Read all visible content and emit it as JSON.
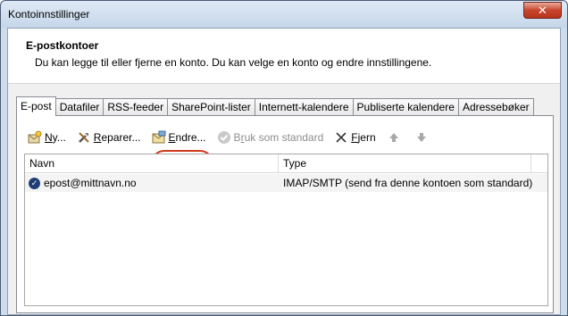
{
  "window": {
    "title": "Kontoinnstillinger",
    "close_glyph": "✕"
  },
  "header": {
    "title": "E-postkontoer",
    "subtitle": "Du kan legge til eller fjerne en konto. Du kan velge en konto og endre innstillingene."
  },
  "tabs": [
    {
      "label": "E-post",
      "active": true
    },
    {
      "label": "Datafiler"
    },
    {
      "label": "RSS-feeder"
    },
    {
      "label": "SharePoint-lister"
    },
    {
      "label": "Internett-kalendere"
    },
    {
      "label": "Publiserte kalendere"
    },
    {
      "label": "Adressebøker"
    }
  ],
  "toolbar": {
    "new": {
      "first": "N",
      "rest": "y...",
      "icon": "new-account-icon"
    },
    "repair": {
      "first": "R",
      "rest": "eparer...",
      "icon": "repair-icon"
    },
    "change": {
      "first": "E",
      "rest": "ndre...",
      "icon": "change-icon"
    },
    "default": {
      "pre": "B",
      "mid": "r",
      "rest": "uk som standard",
      "icon": "checkmark-icon",
      "disabled": true
    },
    "remove": {
      "first": "F",
      "rest": "jern",
      "icon": "remove-x-icon"
    },
    "up_icon": "arrow-up-icon",
    "down_icon": "arrow-down-icon"
  },
  "list": {
    "columns": [
      "Navn",
      "Type"
    ],
    "rows": [
      {
        "name": "epost@mittnavn.no",
        "type": "IMAP/SMTP (send fra denne kontoen som standard)",
        "is_default": true
      }
    ]
  },
  "colors": {
    "highlight_circle": "#d0381c",
    "window_frame": "#cfdcec"
  }
}
